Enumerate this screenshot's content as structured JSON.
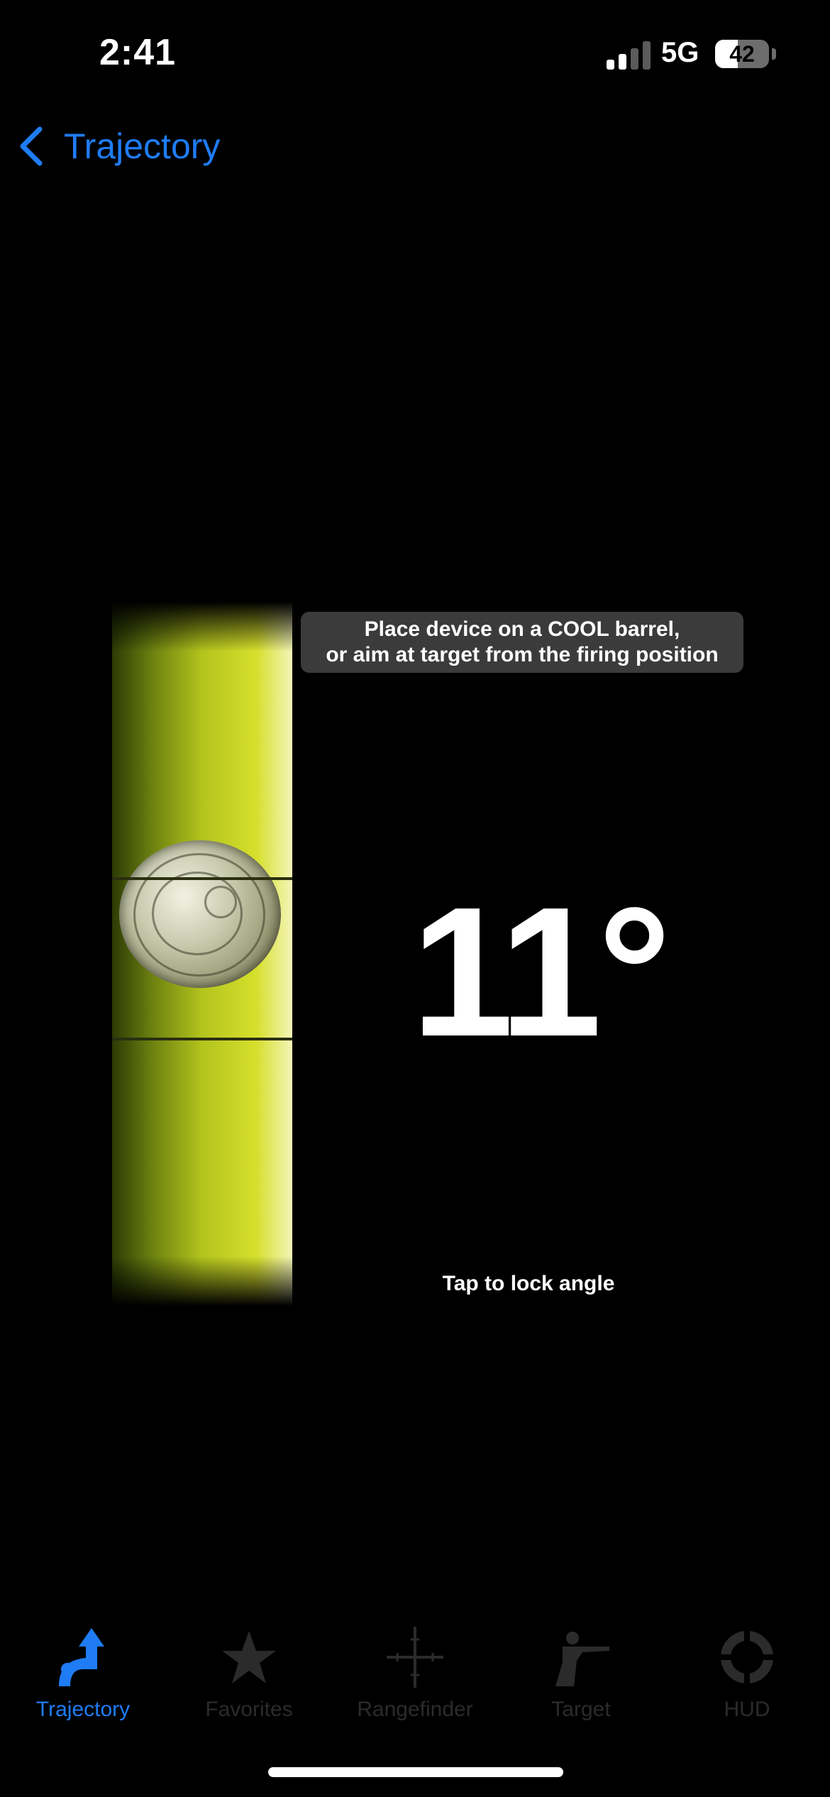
{
  "status_bar": {
    "time": "2:41",
    "network": "5G",
    "battery_percent": "42",
    "signal_bars_active": 2,
    "signal_bars_total": 4
  },
  "nav": {
    "back_label": "Trajectory",
    "back_icon": "chevron-left-icon"
  },
  "level": {
    "hint_text": "Place device on a COOL barrel,\nor aim at target from the firing position",
    "angle": "11°",
    "lock_text": "Tap to lock angle"
  },
  "tab_bar": {
    "active_tab": "Trajectory",
    "tabs": [
      {
        "label": "Trajectory",
        "icon": "trajectory-icon"
      },
      {
        "label": "Favorites",
        "icon": "star-icon"
      },
      {
        "label": "Rangefinder",
        "icon": "crosshair-icon"
      },
      {
        "label": "Target",
        "icon": "shooter-icon"
      },
      {
        "label": "HUD",
        "icon": "hud-reticle-icon"
      }
    ]
  },
  "colors": {
    "accent": "#1f7cf5",
    "tab_inactive": "#2b2b2b",
    "background": "#000000",
    "tooltip_bg": "#3b3b3b"
  }
}
